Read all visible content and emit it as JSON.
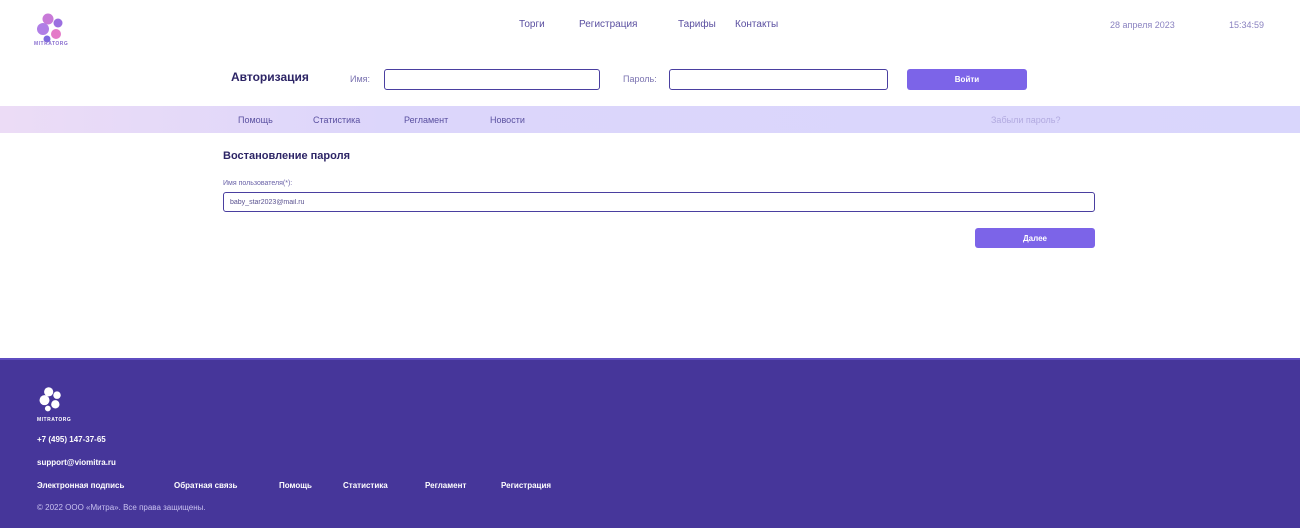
{
  "header": {
    "logo_text": "MITRATORG",
    "nav": {
      "trades": "Торги",
      "register": "Регистрация",
      "tariffs": "Тарифы",
      "contacts": "Контакты"
    },
    "date": "28 апреля 2023",
    "time": "15:34:59"
  },
  "auth": {
    "title": "Авторизация",
    "name_label": "Имя:",
    "name_value": "",
    "password_label": "Пароль:",
    "password_value": "",
    "login_button": "Войти"
  },
  "subnav": {
    "help": "Помощь",
    "stats": "Статистика",
    "rules": "Регламент",
    "news": "Новости",
    "forgot": "Забыли пароль?"
  },
  "main": {
    "title": "Востановление пароля",
    "username_label": "Имя пользователя(*):",
    "username_value": "baby_star2023@mail.ru",
    "next_button": "Далее"
  },
  "footer": {
    "logo_text": "MITRATORG",
    "phone": "+7 (495) 147-37-65",
    "email": "support@viomitra.ru",
    "links": [
      "Электронная подпись",
      "Обратная связь",
      "Помощь",
      "Статистика",
      "Регламент",
      "Регистрация"
    ],
    "copyright": "© 2022 ООО «Митра». Все права защищены."
  },
  "colors": {
    "accent": "#7c64e8",
    "footer_bg": "#46369a",
    "subnav_bg": "#dcd6fb",
    "title": "#2d2566"
  },
  "icons": {
    "logo": "molecule-logo-icon"
  }
}
